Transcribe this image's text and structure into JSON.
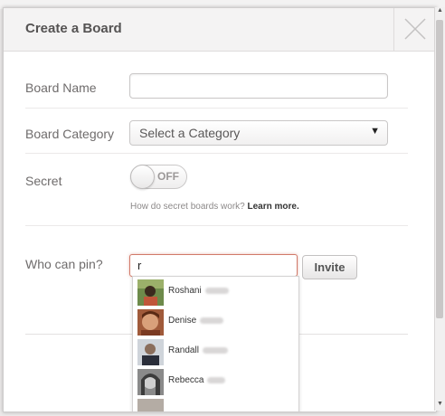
{
  "modal": {
    "title": "Create a Board"
  },
  "form": {
    "board_name_label": "Board Name",
    "board_name_value": "",
    "board_category_label": "Board Category",
    "board_category_value": "Select a Category",
    "secret_label": "Secret",
    "secret_toggle_text": "OFF",
    "help_text": "How do secret boards work? ",
    "help_link": "Learn more.",
    "who_can_pin_label": "Who can pin?",
    "who_can_pin_value": "r",
    "invite_label": "Invite"
  },
  "suggestions": [
    {
      "name": "Roshani",
      "icon": "avatar-roshani"
    },
    {
      "name": "Denise",
      "icon": "avatar-denise"
    },
    {
      "name": "Randall",
      "icon": "avatar-randall"
    },
    {
      "name": "Rebecca",
      "icon": "avatar-rebecca"
    }
  ],
  "colors": {
    "accent_focus_border": "#d17a6a",
    "title_text": "#555353",
    "label_text": "#6f6c6c"
  }
}
